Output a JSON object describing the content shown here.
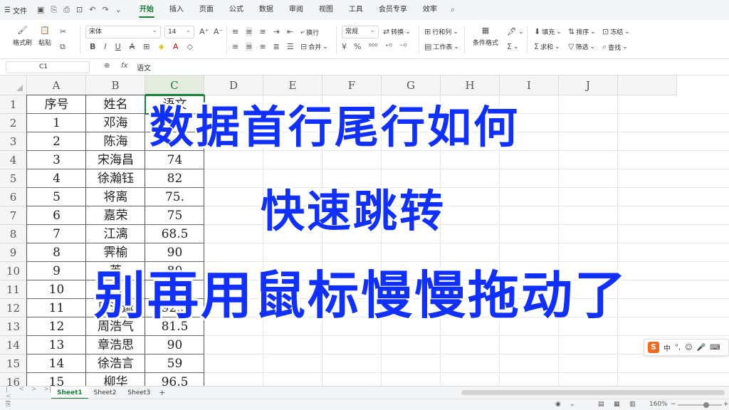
{
  "menu": {
    "file_label": "文件",
    "tabs": [
      "开始",
      "插入",
      "页面",
      "公式",
      "数据",
      "审阅",
      "视图",
      "工具",
      "会员专享",
      "效率"
    ],
    "active_tab": "开始"
  },
  "ribbon": {
    "format_painter": "格式刷",
    "paste": "粘贴",
    "font_name": "宋体",
    "font_size": "14",
    "wrap": "换行",
    "merge": "合并",
    "number_format": "常规",
    "convert": "转换",
    "row_col": "行和列",
    "worksheet": "工作表",
    "cond_format": "条件格式",
    "fill": "填充",
    "sort": "排序",
    "freeze": "冻结",
    "sum": "求和",
    "filter": "筛选",
    "find": "查找"
  },
  "formula_bar": {
    "cell_ref": "C1",
    "fx": "fx",
    "content": "语文"
  },
  "columns": [
    "A",
    "B",
    "C",
    "D",
    "E",
    "F",
    "G",
    "H",
    "I",
    "J"
  ],
  "selected_column": "C",
  "rows": [
    "1",
    "2",
    "3",
    "4",
    "5",
    "6",
    "7",
    "8",
    "9",
    "10",
    "11",
    "12",
    "13",
    "14",
    "15",
    "16"
  ],
  "table": {
    "header": [
      "序号",
      "姓名",
      "语文"
    ],
    "data": [
      [
        "1",
        "邓海",
        "9.5"
      ],
      [
        "2",
        "陈海",
        ".5"
      ],
      [
        "3",
        "宋海昌",
        "74"
      ],
      [
        "4",
        "徐瀚钰",
        "82"
      ],
      [
        "5",
        "将离",
        "75."
      ],
      [
        "6",
        "嘉荣",
        "75"
      ],
      [
        "7",
        "江漓",
        "68.5"
      ],
      [
        "8",
        "霁榆",
        "90"
      ],
      [
        "9",
        "芙",
        "80"
      ],
      [
        "10",
        "冰",
        ".5"
      ],
      [
        "11",
        "周浩邈",
        "92.5"
      ],
      [
        "12",
        "周浩气",
        "81.5"
      ],
      [
        "13",
        "章浩思",
        "90"
      ],
      [
        "14",
        "徐浩言",
        "59"
      ],
      [
        "15",
        "柳华",
        "96.5"
      ]
    ]
  },
  "overlay": {
    "line1": "数据首行尾行如何",
    "line2": "快速跳转",
    "line3": "别再用鼠标慢慢拖动了"
  },
  "ime": {
    "lang": "中"
  },
  "sheets": [
    "Sheet1",
    "Sheet2",
    "Sheet3"
  ],
  "active_sheet": "Sheet1",
  "status": {
    "zoom": "160%"
  },
  "colors": {
    "accent": "#1a7f37",
    "overlay_text": "#1030ff"
  }
}
